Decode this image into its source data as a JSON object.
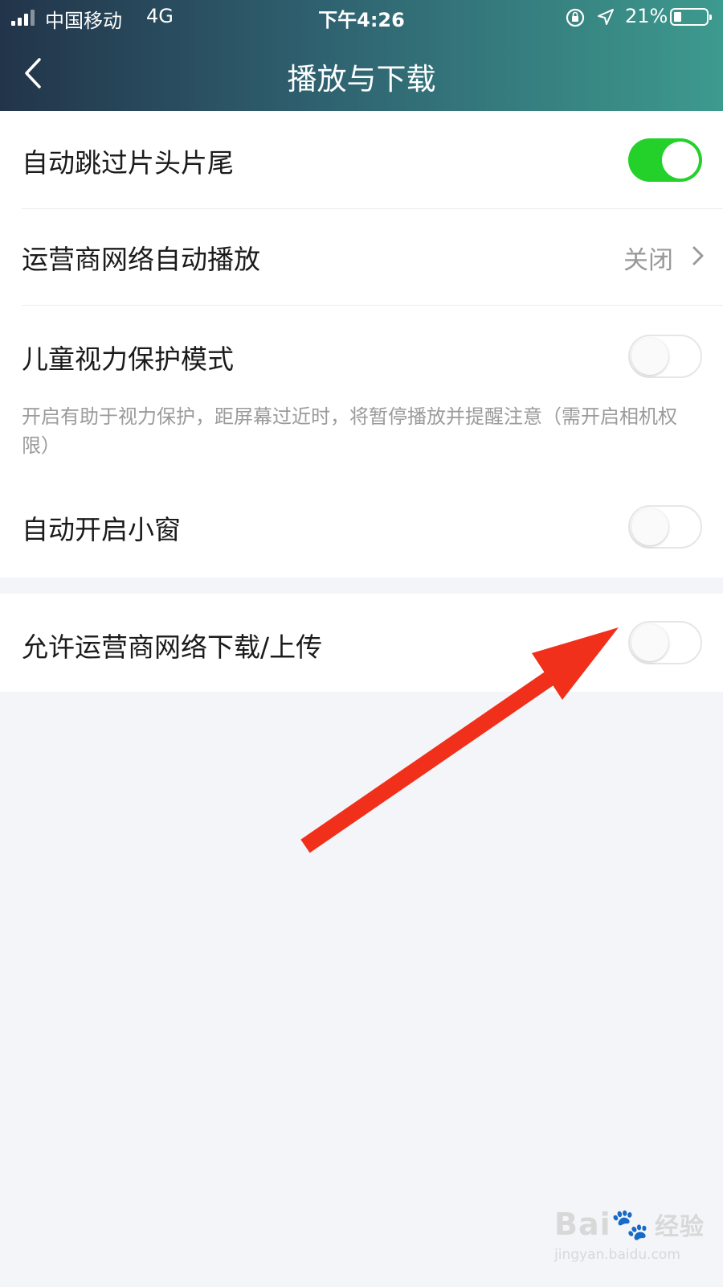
{
  "status_bar": {
    "carrier": "中国移动",
    "network": "4G",
    "time": "下午4:26",
    "battery_percent": "21%",
    "battery_level": 0.21
  },
  "nav": {
    "back_icon": "chevron-left-icon",
    "title": "播放与下载"
  },
  "settings": {
    "skip_intro": {
      "label": "自动跳过片头片尾",
      "enabled": true
    },
    "cellular_autoplay": {
      "label": "运营商网络自动播放",
      "value": "关闭"
    },
    "child_eye_care": {
      "label": "儿童视力保护模式",
      "enabled": false,
      "hint": "开启有助于视力保护，距屏幕过近时，将暂停播放并提醒注意（需开启相机权限）"
    },
    "auto_pip": {
      "label": "自动开启小窗",
      "enabled": false
    },
    "cellular_download": {
      "label": "允许运营商网络下载/上传",
      "enabled": false
    }
  },
  "colors": {
    "toggle_on": "#24d12b",
    "annotation_arrow": "#f0301a"
  },
  "watermark": {
    "logo": "Bai",
    "logo_cn": "经验",
    "url": "jingyan.baidu.com"
  }
}
